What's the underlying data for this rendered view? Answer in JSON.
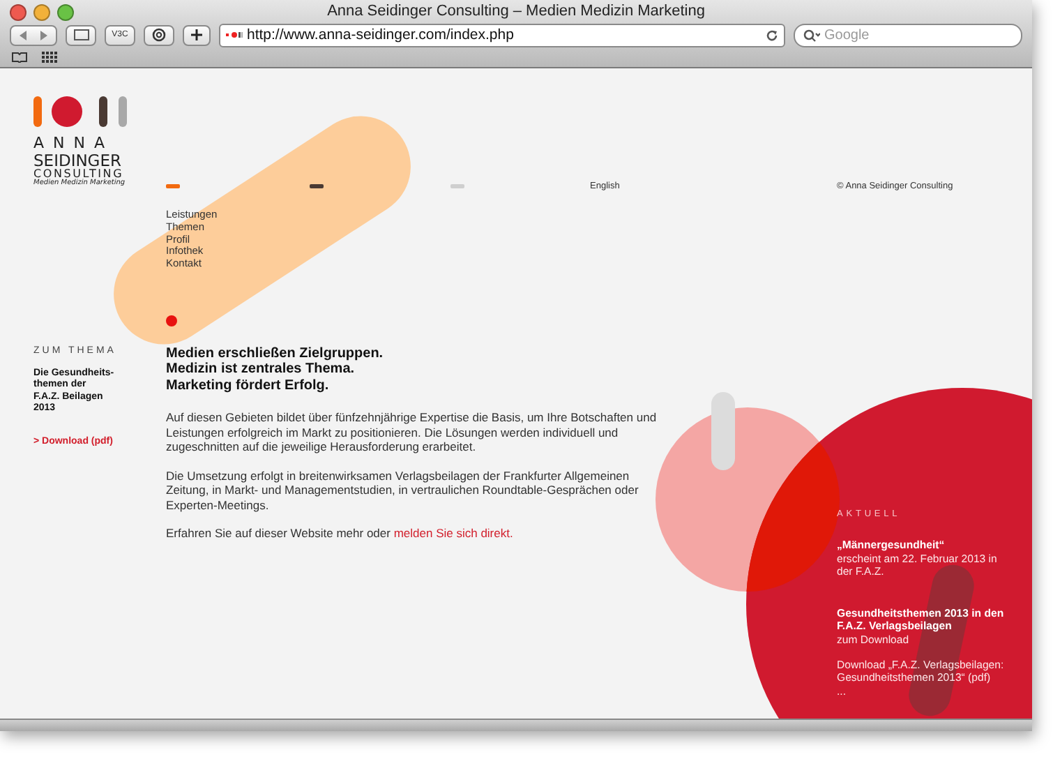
{
  "window": {
    "title": "Anna Seidinger Consulting – Medien Medizin Marketing"
  },
  "toolbar": {
    "url": "http://www.anna-seidinger.com/index.php",
    "search_placeholder": "Google",
    "extension_label": "V3C"
  },
  "logo": {
    "line1": "ANNA",
    "line2": "SEIDINGER",
    "line3": "CONSULTING",
    "tagline": "Medien Medizin Marketing"
  },
  "header": {
    "language": "English",
    "copyright": "© Anna Seidinger Consulting"
  },
  "nav": [
    {
      "label": "Leistungen"
    },
    {
      "label": "Themen"
    },
    {
      "label": "Profil"
    },
    {
      "label": "Infothek"
    },
    {
      "label": "Kontakt"
    }
  ],
  "sidebar": {
    "heading": "ZUM THEMA",
    "text": "Die Gesundheits-\nthemen der\nF.A.Z. Beilagen\n2013",
    "link": "> Download (pdf)"
  },
  "main": {
    "headline": "Medien erschließen Zielgruppen.\nMedizin ist zentrales Thema.\nMarketing fördert Erfolg.",
    "paragraphs": [
      {
        "text": "Auf diesen Gebieten bildet über fünfzehnjährige Expertise die Basis, um Ihre Botschaften und Leistungen erfolgreich im Markt zu positionieren. Die Lösungen werden individuell und zugeschnitten auf die jeweilige Herausforderung erarbeitet."
      },
      {
        "text": "Die Umsetzung erfolgt in breitenwirksamen Verlagsbeilagen der Frankfurter Allgemeinen Zeitung, in Markt- und Managementstudien, in vertraulichen Roundtable-Gesprächen oder Experten-Meetings."
      },
      {
        "text": "Erfahren Sie auf dieser Website mehr oder",
        "link": "melden Sie sich direkt."
      }
    ]
  },
  "news": {
    "heading": "AKTUELL",
    "items": [
      {
        "kind": "headline",
        "title": "„Männergesundheit“",
        "text": "erscheint am 22. Februar 2013 in der F.A.Z."
      },
      {
        "kind": "headline",
        "title": "Gesundheitsthemen 2013 in den F.A.Z. Verlagsbeilagen",
        "text": "zum Download"
      },
      {
        "kind": "download",
        "text": "Download „F.A.Z. Verlagsbeilagen: Gesundheitsthemen 2013“ (pdf)",
        "more": "..."
      }
    ]
  }
}
